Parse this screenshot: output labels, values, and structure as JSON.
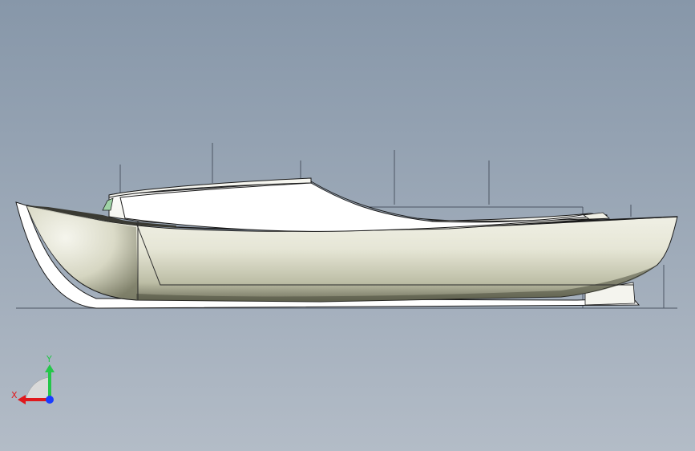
{
  "viewport": {
    "background_top": "#8797a9",
    "background_bottom": "#b3bcc7"
  },
  "model": {
    "hull_color": "#e9e9dc",
    "hull_shadow_color": "#6f705c",
    "edge_color": "#1a1a1a",
    "sketch_line_color": "#4c5563",
    "windshield_color": "#9fd3a6"
  },
  "triad": {
    "x_label": "X",
    "y_label": "Y",
    "x_color": "#e0181c",
    "y_color": "#25c64a",
    "z_color": "#1a3cff",
    "plane_color": "#d9d9d9"
  }
}
